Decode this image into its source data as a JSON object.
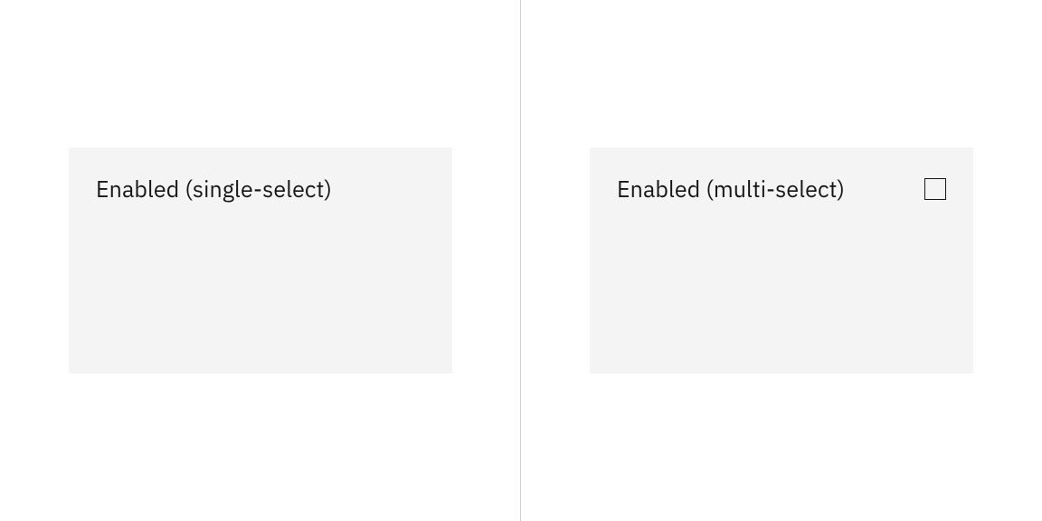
{
  "left_tile": {
    "label": "Enabled (single-select)",
    "has_checkbox": false
  },
  "right_tile": {
    "label": "Enabled (multi-select)",
    "has_checkbox": true,
    "checked": false
  }
}
